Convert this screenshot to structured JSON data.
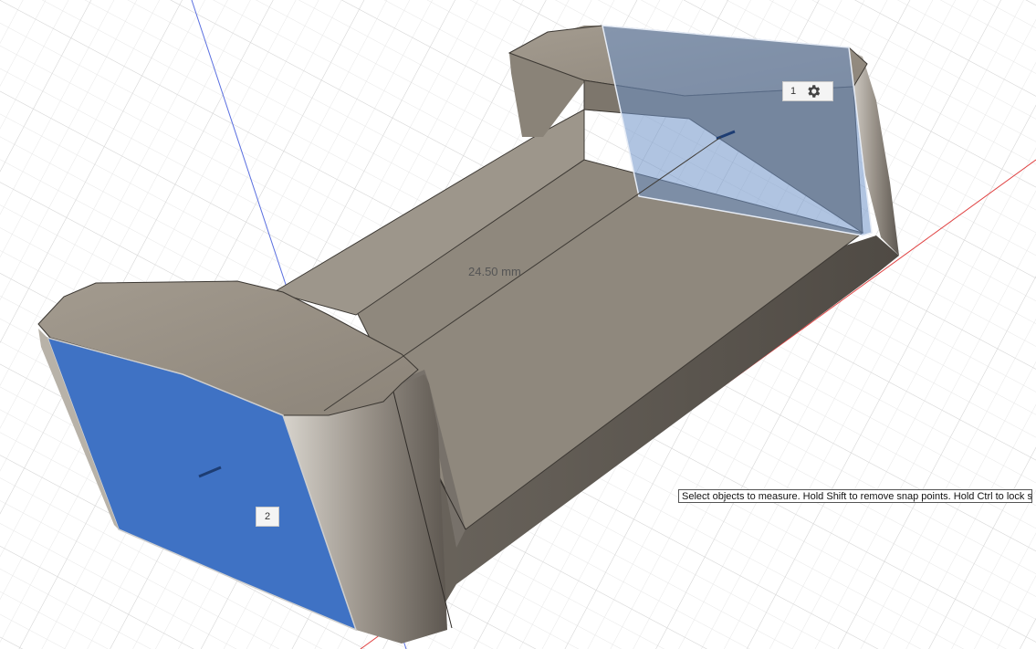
{
  "viewport": {
    "measurement": "24.50 mm",
    "selection_1_number": "1",
    "selection_1_icon": "gear-icon",
    "selection_2_number": "2"
  },
  "status": {
    "tooltip": "Select objects to measure. Hold Shift to remove snap points. Hold Ctrl to lock sna"
  },
  "colors": {
    "selected_face": "#3f72c4",
    "preview_face": "#7f9cc4",
    "body": "#8a8378",
    "axis_x": "#e04040",
    "axis_y": "#5a6fe0"
  }
}
